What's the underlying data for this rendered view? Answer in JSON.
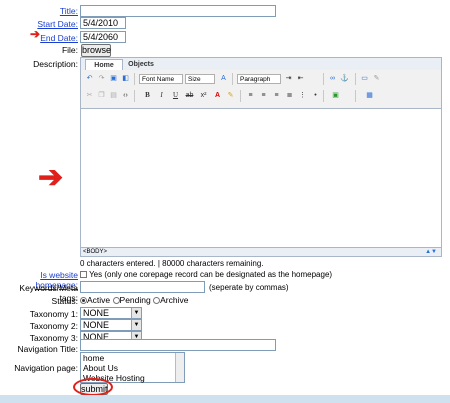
{
  "form": {
    "title_label": "Title:",
    "start_date_label": "Start Date:",
    "start_date_value": "5/4/2010",
    "end_date_label": "End Date:",
    "end_date_value": "5/4/2060",
    "file_label": "File:",
    "browse_label": "browse",
    "description_label": "Description:",
    "homepage_label": "Is website homepage:",
    "homepage_text": "Yes (only one corepage record can be designated as the homepage)",
    "keywords_label": "Keywords/Meta tags:",
    "keywords_hint": "(seperate by commas)",
    "status_label": "Status:",
    "status_options": [
      "Active",
      "Pending",
      "Archive"
    ],
    "taxonomy1_label": "Taxonomy 1:",
    "taxonomy2_label": "Taxonomy 2:",
    "taxonomy3_label": "Taxonomy 3:",
    "taxonomy_value": "NONE",
    "nav_title_label": "Navigation Title:",
    "nav_page_label": "Navigation page:",
    "nav_pages": [
      "home",
      "About Us",
      "Website Hosting"
    ],
    "submit_label": "submit"
  },
  "editor": {
    "tabs": [
      "Home",
      "Objects"
    ],
    "font_name": "Font Name",
    "size": "Size",
    "paragraph": "Paragraph",
    "status_tag": "<BODY>",
    "char_count": "0 characters entered.  |  80000 characters remaining."
  },
  "colors": {
    "link": "#1a3ecf",
    "annotation_red": "#e0201a"
  }
}
